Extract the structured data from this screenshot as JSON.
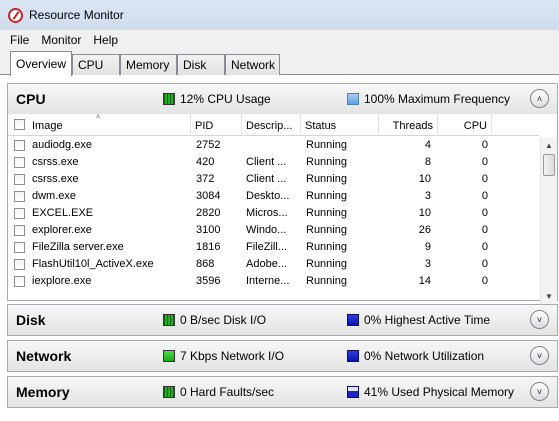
{
  "window": {
    "title": "Resource Monitor"
  },
  "menu": [
    "File",
    "Monitor",
    "Help"
  ],
  "tabs": [
    "Overview",
    "CPU",
    "Memory",
    "Disk",
    "Network"
  ],
  "active_tab": "Overview",
  "cpu": {
    "title": "CPU",
    "usage_label": "12% CPU Usage",
    "frequency_label": "100% Maximum Frequency",
    "columns": [
      "Image",
      "PID",
      "Descrip...",
      "Status",
      "Threads",
      "CPU"
    ],
    "rows": [
      {
        "image": "audiodg.exe",
        "pid": "2752",
        "desc": "",
        "status": "Running",
        "threads": "4",
        "cpu": "0"
      },
      {
        "image": "csrss.exe",
        "pid": "420",
        "desc": "Client ...",
        "status": "Running",
        "threads": "8",
        "cpu": "0"
      },
      {
        "image": "csrss.exe",
        "pid": "372",
        "desc": "Client ...",
        "status": "Running",
        "threads": "10",
        "cpu": "0"
      },
      {
        "image": "dwm.exe",
        "pid": "3084",
        "desc": "Deskto...",
        "status": "Running",
        "threads": "3",
        "cpu": "0"
      },
      {
        "image": "EXCEL.EXE",
        "pid": "2820",
        "desc": "Micros...",
        "status": "Running",
        "threads": "10",
        "cpu": "0"
      },
      {
        "image": "explorer.exe",
        "pid": "3100",
        "desc": "Windo...",
        "status": "Running",
        "threads": "26",
        "cpu": "0"
      },
      {
        "image": "FileZilla server.exe",
        "pid": "1816",
        "desc": "FileZill...",
        "status": "Running",
        "threads": "9",
        "cpu": "0"
      },
      {
        "image": "FlashUtil10l_ActiveX.exe",
        "pid": "868",
        "desc": "Adobe...",
        "status": "Running",
        "threads": "3",
        "cpu": "0"
      },
      {
        "image": "iexplore.exe",
        "pid": "3596",
        "desc": "Interne...",
        "status": "Running",
        "threads": "14",
        "cpu": "0"
      }
    ]
  },
  "disk": {
    "title": "Disk",
    "io_label": "0 B/sec Disk I/O",
    "active_label": "0% Highest Active Time"
  },
  "network": {
    "title": "Network",
    "io_label": "7 Kbps Network I/O",
    "util_label": "0% Network Utilization"
  },
  "memory": {
    "title": "Memory",
    "faults_label": "0 Hard Faults/sec",
    "used_label": "41% Used Physical Memory"
  },
  "icons": {
    "collapse": "chevron-up-icon",
    "expand": "chevron-down-icon",
    "scroll_up": "arrow-up-icon",
    "scroll_down": "arrow-down-icon",
    "scroll_left": "arrow-left-icon",
    "scroll_right": "arrow-right-icon"
  },
  "colors": {
    "cpu_usage": "#2a9a2a",
    "max_frequency": "#6aaae8",
    "disk_activity": "#0c16a8",
    "network_io": "#2cc52c"
  }
}
